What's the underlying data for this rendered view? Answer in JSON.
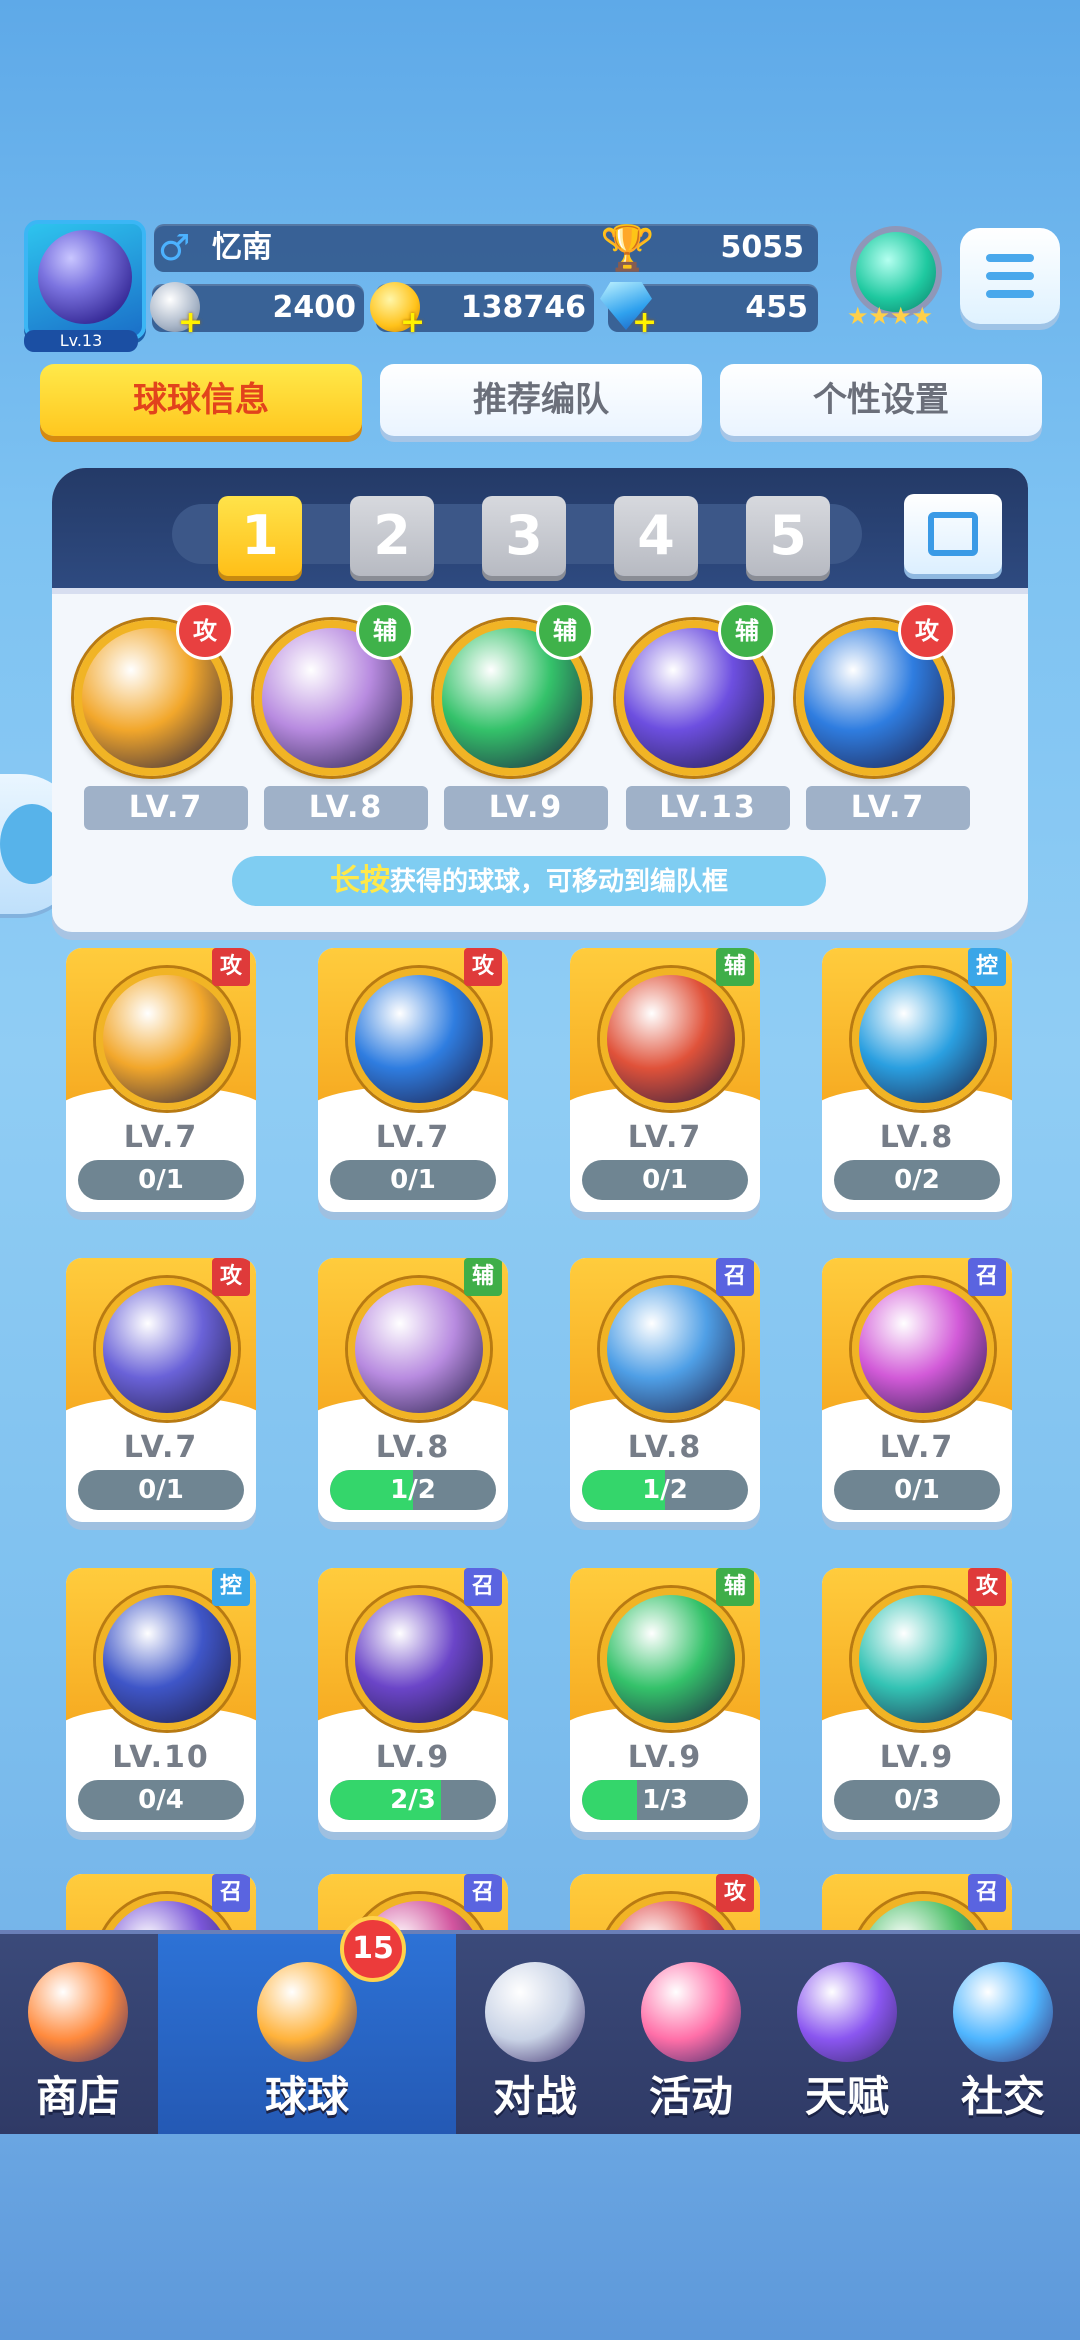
{
  "player": {
    "level": "Lv.13",
    "name": "忆南",
    "trophies": "5055",
    "silver": "2400",
    "gold": "138746",
    "gems": "455"
  },
  "tabs": [
    "球球信息",
    "推荐编队",
    "个性设置"
  ],
  "team_slots": [
    "1",
    "2",
    "3",
    "4",
    "5"
  ],
  "team": [
    {
      "type": "攻",
      "level": "LV.7",
      "color": "#f2a72b"
    },
    {
      "type": "辅",
      "level": "LV.8",
      "color": "#b88be0"
    },
    {
      "type": "辅",
      "level": "LV.9",
      "color": "#34c26a"
    },
    {
      "type": "辅",
      "level": "LV.13",
      "color": "#6d4fe0"
    },
    {
      "type": "攻",
      "level": "LV.7",
      "color": "#2f7de0"
    }
  ],
  "hint": {
    "highlight": "长按",
    "text": "获得的球球，可移动到编队框"
  },
  "balls": [
    {
      "type": "攻",
      "level": "LV.7",
      "progress": "0/1",
      "fill": 0,
      "color": "#f2a72b"
    },
    {
      "type": "攻",
      "level": "LV.7",
      "progress": "0/1",
      "fill": 0,
      "color": "#2f7de0"
    },
    {
      "type": "辅",
      "level": "LV.7",
      "progress": "0/1",
      "fill": 0,
      "color": "#e0523a"
    },
    {
      "type": "控",
      "level": "LV.8",
      "progress": "0/2",
      "fill": 0,
      "color": "#2a9fe0"
    },
    {
      "type": "攻",
      "level": "LV.7",
      "progress": "0/1",
      "fill": 0,
      "color": "#6a62d8"
    },
    {
      "type": "辅",
      "level": "LV.8",
      "progress": "1/2",
      "fill": 0.5,
      "color": "#b88be0"
    },
    {
      "type": "召",
      "level": "LV.8",
      "progress": "1/2",
      "fill": 0.5,
      "color": "#4f9fe6"
    },
    {
      "type": "召",
      "level": "LV.7",
      "progress": "0/1",
      "fill": 0,
      "color": "#d25ad8"
    },
    {
      "type": "控",
      "level": "LV.10",
      "progress": "0/4",
      "fill": 0,
      "color": "#3f56c8"
    },
    {
      "type": "召",
      "level": "LV.9",
      "progress": "2/3",
      "fill": 0.67,
      "color": "#6b45c8"
    },
    {
      "type": "辅",
      "level": "LV.9",
      "progress": "1/3",
      "fill": 0.33,
      "color": "#34c26a"
    },
    {
      "type": "攻",
      "level": "LV.9",
      "progress": "0/3",
      "fill": 0,
      "color": "#33c3b4"
    },
    {
      "type": "召",
      "color": "#7a56d8"
    },
    {
      "type": "召",
      "color": "#d2559f"
    },
    {
      "type": "攻",
      "color": "#e04a4a"
    },
    {
      "type": "召",
      "color": "#4ec06a"
    }
  ],
  "nav": [
    {
      "label": "商店",
      "icon": "shop-icon"
    },
    {
      "label": "球球",
      "icon": "ball-icon",
      "badge": "15"
    },
    {
      "label": "对战",
      "icon": "swords-icon"
    },
    {
      "label": "活动",
      "icon": "party-popper-icon"
    },
    {
      "label": "天赋",
      "icon": "planet-icon"
    },
    {
      "label": "社交",
      "icon": "chat-heart-icon"
    }
  ]
}
